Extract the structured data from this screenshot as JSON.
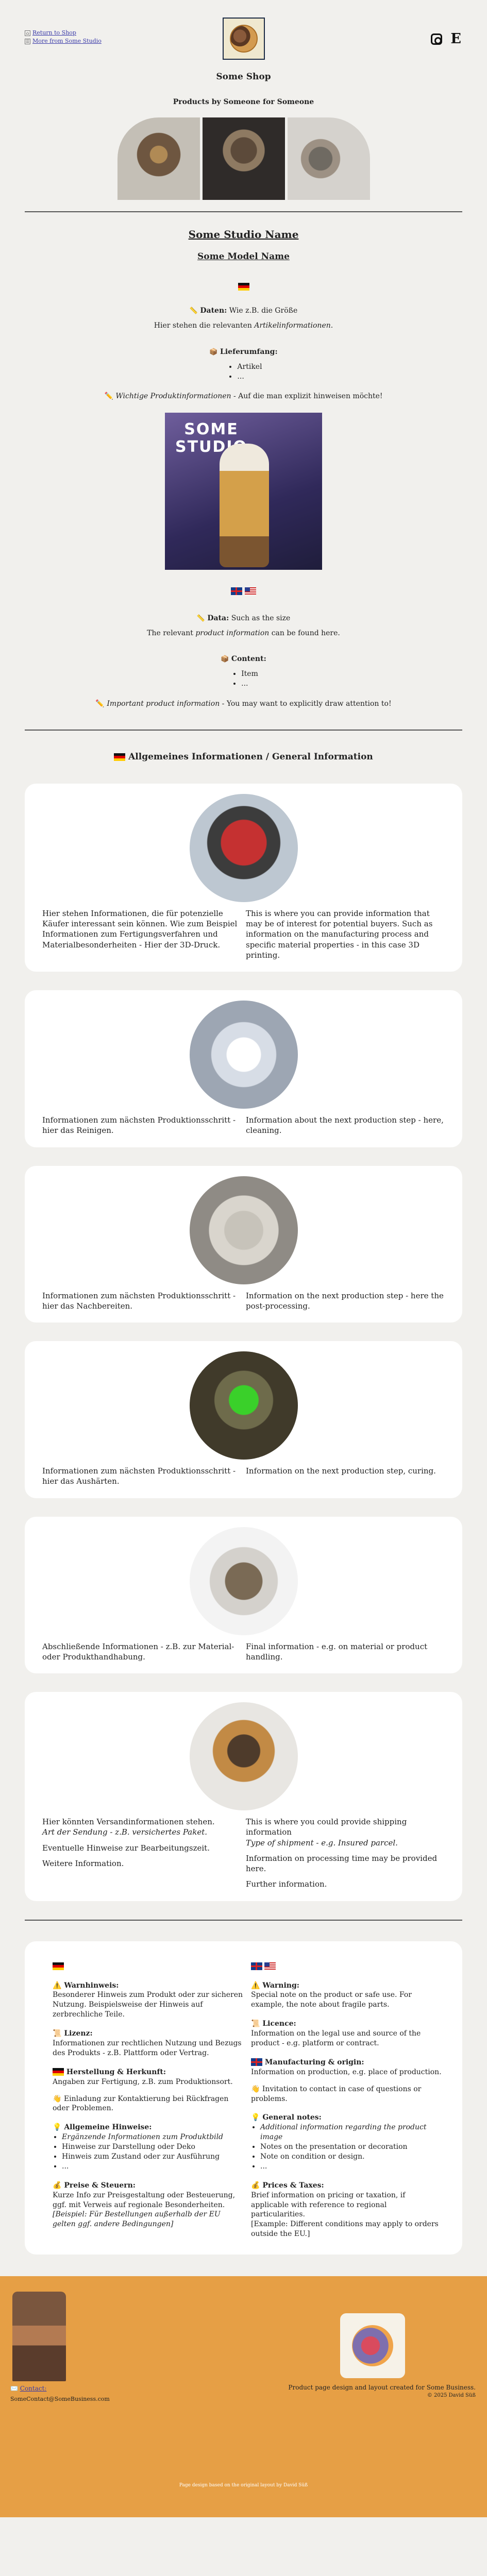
{
  "top_links": {
    "return": "Return to Shop",
    "more": "More from Some Studio"
  },
  "shop": {
    "title": "Some Shop",
    "subtitle": "Products by Someone for Someone"
  },
  "studio": {
    "name": "Some Studio Name",
    "model": "Some Model Name"
  },
  "german": {
    "data_label": "Daten:",
    "data_value": "Wie z.B. die Größe",
    "data_note_prefix": "Hier stehen die relevanten ",
    "data_note_em": "Artikelinformationen",
    "data_note_suffix": ".",
    "scope_label": "Lieferumfang:",
    "scope_items": [
      "Artikel",
      "..."
    ],
    "warning_prefix": "Wichtige Produktinformationen",
    "warning_suffix": " - Auf die man explizit hinweisen möchte!"
  },
  "photo_text": "SOME\nSTUDIO",
  "english": {
    "data_label": "Data:",
    "data_value": "Such as the size",
    "data_note_prefix": "The relevant ",
    "data_note_em": "product information",
    "data_note_suffix": " can be found here.",
    "scope_label": "Content:",
    "scope_items": [
      "Item",
      "..."
    ],
    "warning_prefix": "Important product information",
    "warning_suffix": " - You may want to explicitly draw attention to!"
  },
  "general_info_title": " Allgemeines Informationen /  General Information",
  "cards": [
    {
      "de": "Hier stehen Informationen, die für potenzielle Käufer interessant sein können. Wie zum Beispiel Informationen zum Fertigungsverfahren und Materialbesonderheiten - Hier der 3D-Druck.",
      "en": "This is where you can provide information that may be of interest for potential buyers. Such as information on the manufacturing process and specific material properties - in this case 3D printing."
    },
    {
      "de": "Informationen zum nächsten Produktionsschritt - hier das Reinigen.",
      "en": "Information about the next production step - here, cleaning."
    },
    {
      "de": "Informationen zum nächsten Produktionsschritt - hier das Nachbereiten.",
      "en": "Information on the next production step - here the post-processing."
    },
    {
      "de": "Informationen zum nächsten Produktionsschritt - hier das Aushärten.",
      "en": "Information on the next production step, curing."
    },
    {
      "de": "Abschließende Informationen - z.B. zur Material- oder Produkthandhabung.",
      "en": "Final information - e.g. on material or product handling."
    },
    {
      "de_p1": "Hier könnten Versandinformationen stehen.",
      "de_p2": "Art der Sendung - z.B. versichertes Paket.",
      "de_p3": "Eventuelle Hinweise zur Bearbeitungszeit.",
      "de_p4": "Weitere Information.",
      "en_p1": "This is where you could provide shipping information",
      "en_p2": "Type of shipment - e.g. Insured parcel.",
      "en_p3": "Information on processing time may be provided here.",
      "en_p4": "Further information."
    }
  ],
  "footer_de": {
    "warn_title": "Warnhinweis:",
    "warn_text": "Besonderer Hinweis zum Produkt oder zur sicheren Nutzung. Beispielsweise der Hinweis auf zerbrechliche Teile.",
    "license_title": "Lizenz:",
    "license_text": "Informationen zur rechtlichen Nutzung und Bezugs des Produkts - z.B. Plattform oder Vertrag.",
    "origin_title": "Herstellung & Herkunft:",
    "origin_text": "Angaben zur Fertigung, z.B. zum Produktionsort.",
    "invite_text": "Einladung zur Kontaktierung bei Rückfragen oder Problemen.",
    "general_title": "Allgemeine Hinweise:",
    "general_items": [
      "Ergänzende Informationen zum Produktbild",
      "Hinweise zur Darstellung oder Deko",
      "Hinweis zum Zustand oder zur Ausführung",
      "..."
    ],
    "price_title": "Preise & Steuern:",
    "price_text": "Kurze Info zur Preisgestaltung oder Besteuerung, ggf. mit Verweis auf regionale Besonderheiten.",
    "price_note": "[Beispiel: Für Bestellungen außerhalb der EU gelten ggf. andere Bedingungen]"
  },
  "footer_en": {
    "warn_title": "Warning:",
    "warn_text": "Special note on the product or safe use. For example, the note about fragile parts.",
    "license_title": "Licence:",
    "license_text": "Information on the legal use and source of the product - e.g. platform or contract.",
    "origin_title": "Manufacturing & origin:",
    "origin_text": "Information on production, e.g. place of production.",
    "invite_text": "Invitation to contact in case of questions or problems.",
    "general_title": "General notes:",
    "general_items": [
      "Additional information regarding the product image",
      "Notes on the presentation or decoration",
      "Note on condition or design.",
      "..."
    ],
    "price_title": "Prices & Taxes:",
    "price_text": "Brief information on pricing or taxation, if applicable with reference to regional particularities.",
    "price_note": "[Example: Different conditions may apply to orders outside the EU.]"
  },
  "bottom": {
    "contact": "Contact:",
    "email": "SomeContact@SomeBusiness.com",
    "credit": "Product page design and layout created for Some Business.",
    "copyright": "© 2025 David Süß",
    "footer_note": "Page design based on the original layout by David Süß"
  }
}
